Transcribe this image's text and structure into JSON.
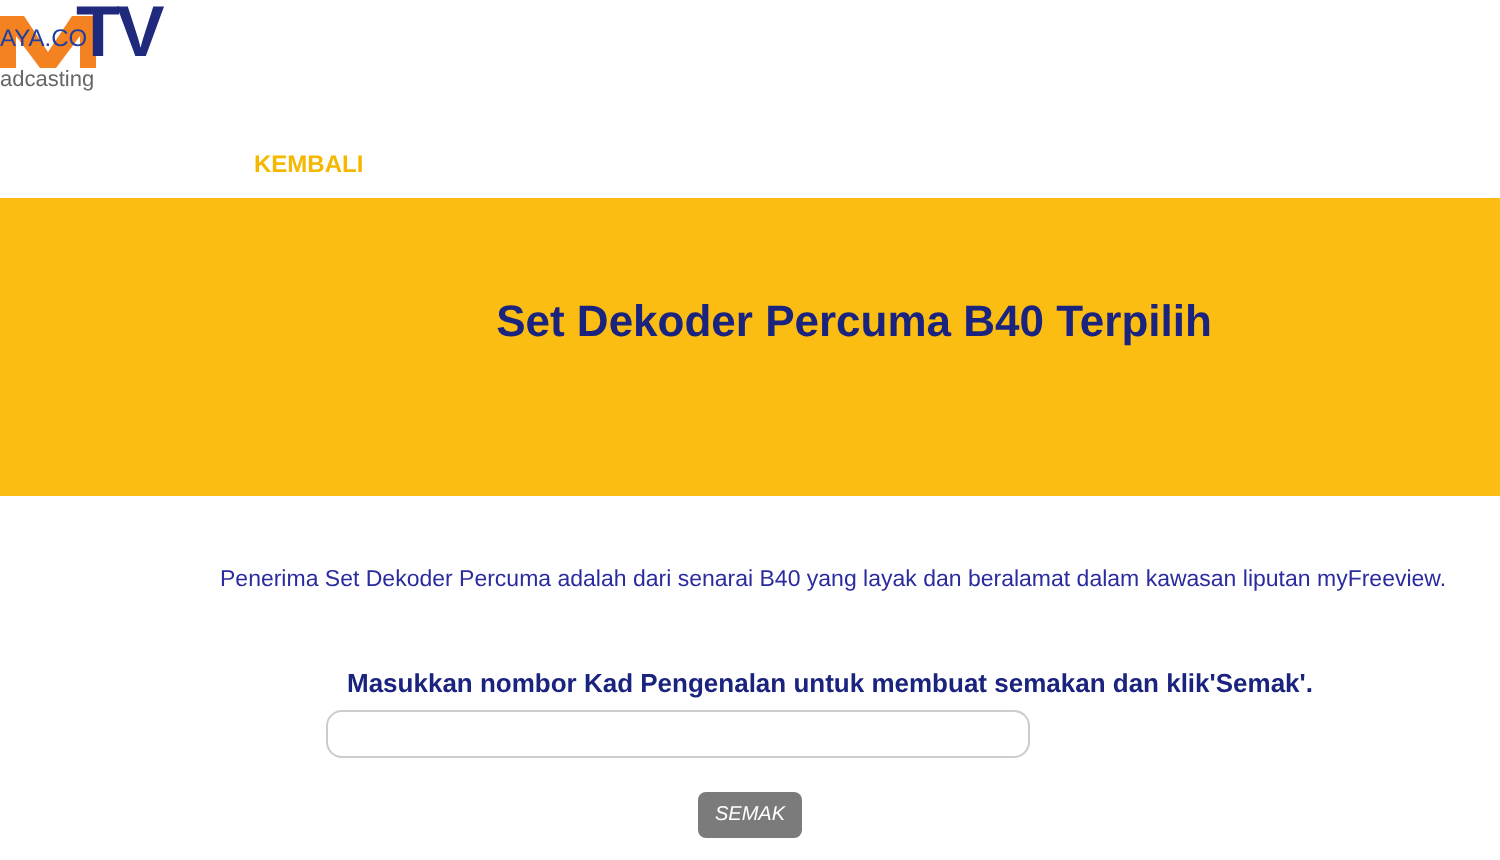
{
  "logo": {
    "mark": "TV",
    "domain": "AYA.CO",
    "tagline": "adcasting"
  },
  "nav": {
    "back_link": "KEMBALI"
  },
  "banner": {
    "title": "Set Dekoder Percuma B40 Terpilih"
  },
  "info": "Penerima Set Dekoder Percuma adalah dari senarai B40 yang layak dan beralamat dalam kawasan liputan myFreeview.",
  "form": {
    "instruction": "Masukkan nombor Kad Pengenalan untuk membuat semakan dan klik'Semak'.",
    "submit": "SEMAK"
  }
}
